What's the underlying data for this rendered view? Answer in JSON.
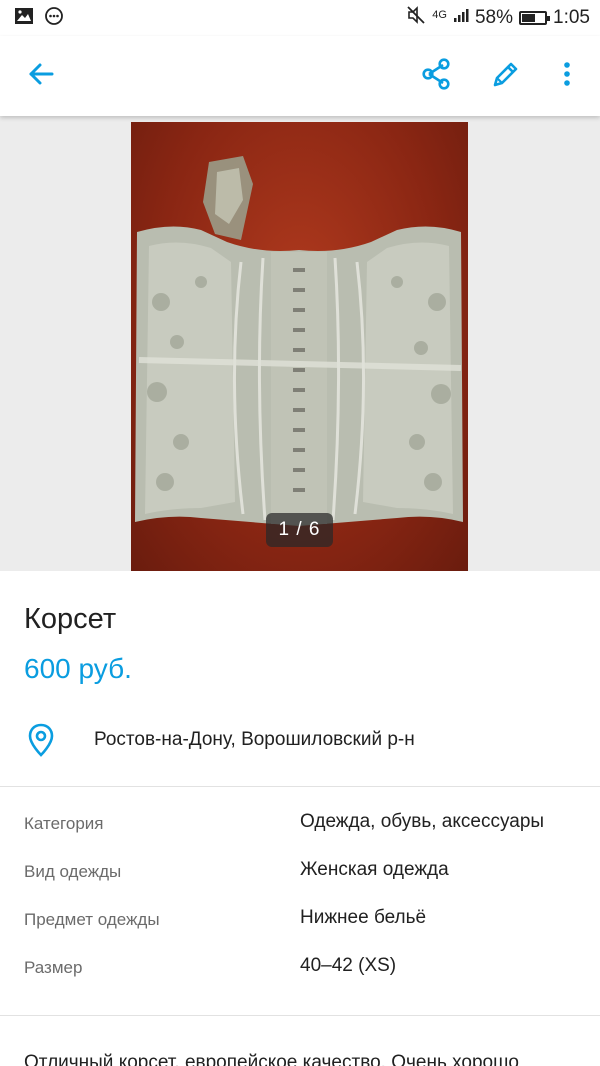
{
  "status_bar": {
    "network": "4G",
    "battery_text": "58%",
    "battery_level": 0.58,
    "time": "1:05",
    "icons": [
      "image-notification-icon",
      "more-notification-icon",
      "mute-icon",
      "signal-icon",
      "battery-icon"
    ]
  },
  "app_bar": {
    "back_icon": "arrow-left-icon",
    "share_icon": "share-icon",
    "edit_icon": "pencil-icon",
    "menu_icon": "more-vert-icon",
    "accent_color": "#0a9de0"
  },
  "gallery": {
    "counter": "1 / 6"
  },
  "listing": {
    "title": "Корсет",
    "price": "600 руб.",
    "location_icon": "location-pin-icon",
    "location": "Ростов-на-Дону, Ворошиловский р-н"
  },
  "params": [
    {
      "label": "Категория",
      "value": "Одежда, обувь, аксессуары"
    },
    {
      "label": "Вид одежды",
      "value": "Женская одежда"
    },
    {
      "label": "Предмет одежды",
      "value": "Нижнее бельё"
    },
    {
      "label": "Размер",
      "value": "40–42 (XS)"
    }
  ],
  "description": "Отличный корсет, европейское качество. Очень хорошо"
}
